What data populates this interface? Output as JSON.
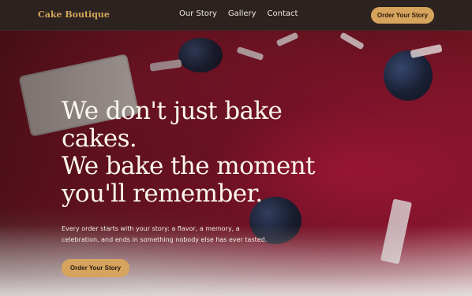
{
  "header": {
    "brand": "Cake Boutique",
    "nav": [
      "Our Story",
      "Gallery",
      "Contact"
    ],
    "cta_label": "Order Your Story"
  },
  "hero": {
    "headline_lines": [
      "We don't just bake",
      "cakes.",
      "We bake the moment",
      "you'll remember."
    ],
    "subtitle": "Every order starts with your story: a flavor, a memory, a celebration, and ends in something nobody else has ever tasted.",
    "cta_label": "Order Your Story",
    "background": "red velvet cake with blueberries and white chocolate"
  },
  "colors": {
    "accent": "#d6a45c",
    "nav_bg": "#2c2220",
    "brand_text": "#d3a65b",
    "headline": "#fbf6f0"
  }
}
